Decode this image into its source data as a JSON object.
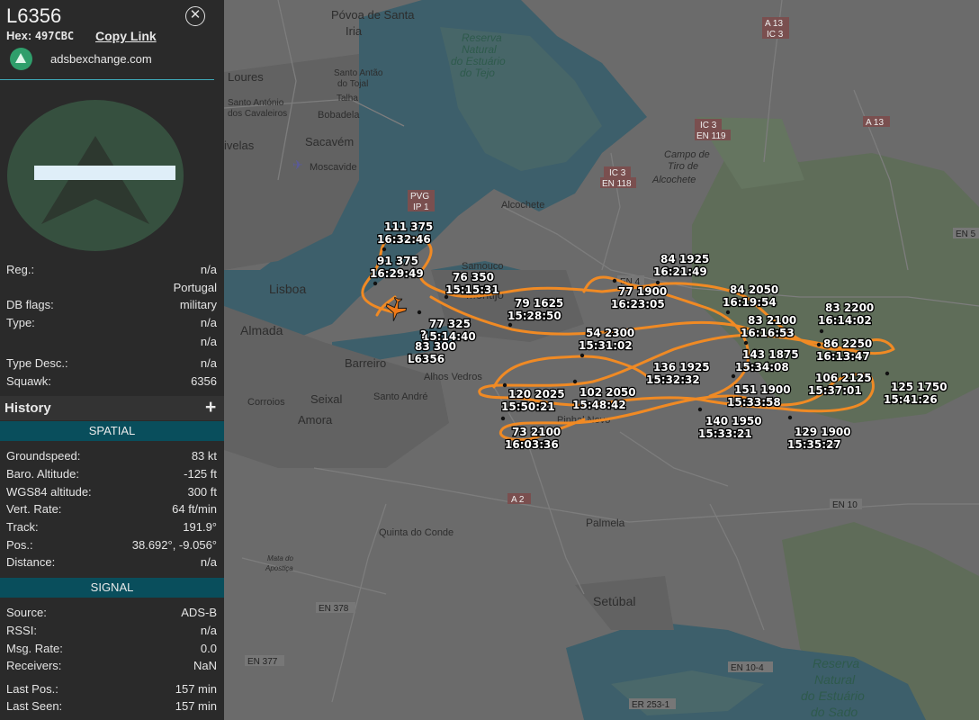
{
  "aircraft": {
    "callsign": "L6356",
    "hex_label": "Hex:",
    "hex": "497CBC",
    "copy_link": "Copy Link",
    "source_site": "adsbexchange.com",
    "close_icon": "close-icon"
  },
  "details": [
    {
      "label": "Reg.:",
      "value": "n/a"
    },
    {
      "label": "",
      "value": "Portugal"
    },
    {
      "label": "DB flags:",
      "value": "military"
    },
    {
      "label": "Type:",
      "value": "n/a"
    },
    {
      "label": "",
      "value": "n/a"
    },
    {
      "label": "Type Desc.:",
      "value": "n/a"
    },
    {
      "label": "Squawk:",
      "value": "6356"
    }
  ],
  "history": {
    "title": "History",
    "plus": "+"
  },
  "spatial": {
    "header": "SPATIAL",
    "rows": [
      {
        "label": "Groundspeed:",
        "value": "83 kt"
      },
      {
        "label": "Baro. Altitude:",
        "value": "-125 ft"
      },
      {
        "label": "WGS84 altitude:",
        "value": "300 ft"
      },
      {
        "label": "Vert. Rate:",
        "value": "64 ft/min"
      },
      {
        "label": "Track:",
        "value": "191.9°"
      },
      {
        "label": "Pos.:",
        "value": "38.692°, -9.056°"
      },
      {
        "label": "Distance:",
        "value": "n/a"
      }
    ]
  },
  "signal": {
    "header": "SIGNAL",
    "rows": [
      {
        "label": "Source:",
        "value": "ADS-B"
      },
      {
        "label": "RSSI:",
        "value": "n/a"
      },
      {
        "label": "Msg. Rate:",
        "value": "0.0"
      },
      {
        "label": "Receivers:",
        "value": "NaN"
      },
      {
        "label": "Last Pos.:",
        "value": "157 min"
      },
      {
        "label": "Last Seen:",
        "value": "157 min"
      }
    ]
  },
  "colors": {
    "track": "#f08a24",
    "section_header": "#094e5c",
    "water": "#3b5f6b",
    "land": "#6a6a6a",
    "park": "#5a6d55"
  },
  "map": {
    "places": [
      {
        "name": "Póvoa de Santa",
        "size": 13
      },
      {
        "name": "Iria",
        "size": 13
      },
      {
        "name": "Loures",
        "size": 13
      },
      {
        "name": "Santo Antão",
        "size": 10
      },
      {
        "name": "do Tojal",
        "size": 10
      },
      {
        "name": "Sacavém",
        "size": 13
      },
      {
        "name": "Moscavide",
        "size": 11
      },
      {
        "name": "Bobadela",
        "size": 11
      },
      {
        "name": "Santo António",
        "size": 10
      },
      {
        "name": "dos Cavaleiros",
        "size": 10
      },
      {
        "name": "Talha",
        "size": 10
      },
      {
        "name": "ivelas",
        "size": 13
      },
      {
        "name": "Lisboa",
        "size": 14
      },
      {
        "name": "Almada",
        "size": 14
      },
      {
        "name": "Barreiro",
        "size": 13
      },
      {
        "name": "Seixal",
        "size": 13
      },
      {
        "name": "Amora",
        "size": 13
      },
      {
        "name": "Corroios",
        "size": 11
      },
      {
        "name": "Santo André",
        "size": 11
      },
      {
        "name": "Alhos Vedros",
        "size": 11
      },
      {
        "name": "Samouco",
        "size": 11
      },
      {
        "name": "Montijo",
        "size": 13
      },
      {
        "name": "Alcochete",
        "size": 11
      },
      {
        "name": "Pinhal Novo",
        "size": 11
      },
      {
        "name": "Quinta do Conde",
        "size": 11
      },
      {
        "name": "Palmela",
        "size": 12
      },
      {
        "name": "Setúbal",
        "size": 14
      },
      {
        "name": "Mata do",
        "size": 8
      },
      {
        "name": "Apostiça",
        "size": 8
      },
      {
        "name": "Campo de",
        "size": 11
      },
      {
        "name": "Tiro de",
        "size": 11
      },
      {
        "name": "Alcochete",
        "size": 11
      }
    ],
    "reserves": [
      [
        "Reserva",
        "Natural",
        "do Estuário",
        "do Tejo"
      ],
      [
        "Reserva",
        "Natural",
        "do Estuário",
        "do Sado"
      ]
    ],
    "road_shields": [
      "A 13",
      "IC 3",
      "A 13",
      "IC 3",
      "EN 119",
      "IC 3",
      "EN 118",
      "PVG",
      "IP 1",
      "EN 4",
      "EN 5",
      "A 2",
      "EN 10",
      "EN 378",
      "EN 377",
      "EN 10-4",
      "ER 253-1"
    ],
    "track_labels": [
      {
        "a": "111",
        "b": "375",
        "time": "16:32:46"
      },
      {
        "a": "91",
        "b": "375",
        "time": "16:29:49"
      },
      {
        "a": "76",
        "b": "350",
        "time": "15:15:31"
      },
      {
        "a": "79",
        "b": "1625",
        "time": "15:28:50"
      },
      {
        "a": "77",
        "b": "325",
        "time": "15:14:40"
      },
      {
        "a": "?",
        "b": "",
        "time": ""
      },
      {
        "a": "83",
        "b": "300",
        "time": "L6356"
      },
      {
        "a": "84",
        "b": "1925",
        "time": "16:21:49"
      },
      {
        "a": "77",
        "b": "1900",
        "time": "16:23:05"
      },
      {
        "a": "84",
        "b": "2050",
        "time": "16:19:54"
      },
      {
        "a": "83",
        "b": "2100",
        "time": "16:16:53"
      },
      {
        "a": "83",
        "b": "2200",
        "time": "16:14:02"
      },
      {
        "a": "86",
        "b": "2250",
        "time": "16:13:47"
      },
      {
        "a": "54",
        "b": "2300",
        "time": "15:31:02"
      },
      {
        "a": "143",
        "b": "1875",
        "time": "15:34:08"
      },
      {
        "a": "136",
        "b": "1925",
        "time": "15:32:32"
      },
      {
        "a": "151",
        "b": "1900",
        "time": "15:33:58"
      },
      {
        "a": "106",
        "b": "2125",
        "time": "15:37:01"
      },
      {
        "a": "125",
        "b": "1750",
        "time": "15:41:26"
      },
      {
        "a": "120",
        "b": "2025",
        "time": "15:50:21"
      },
      {
        "a": "102",
        "b": "2050",
        "time": "15:48:42"
      },
      {
        "a": "140",
        "b": "1950",
        "time": "15:33:21"
      },
      {
        "a": "129",
        "b": "1900",
        "time": "15:35:27"
      },
      {
        "a": "73",
        "b": "2100",
        "time": "16:03:36"
      }
    ]
  }
}
